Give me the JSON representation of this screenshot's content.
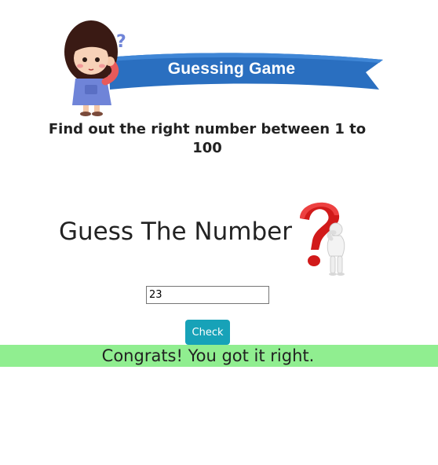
{
  "banner": {
    "title": "Guessing Game"
  },
  "instructions": {
    "text": "Find out the right number between 1 to 100"
  },
  "heading": {
    "text": "Guess The Number"
  },
  "guess_input": {
    "value": "23"
  },
  "check_button": {
    "label": "Check"
  },
  "result": {
    "text": "Congrats! You got it right."
  },
  "colors": {
    "banner_blue": "#2a6fc0",
    "button_teal": "#17a2b8",
    "result_green": "#90ee90",
    "question_red": "#d11a1a"
  },
  "icons": {
    "mascot": "thinking-girl-icon",
    "question_figure": "question-mark-figure-icon"
  }
}
